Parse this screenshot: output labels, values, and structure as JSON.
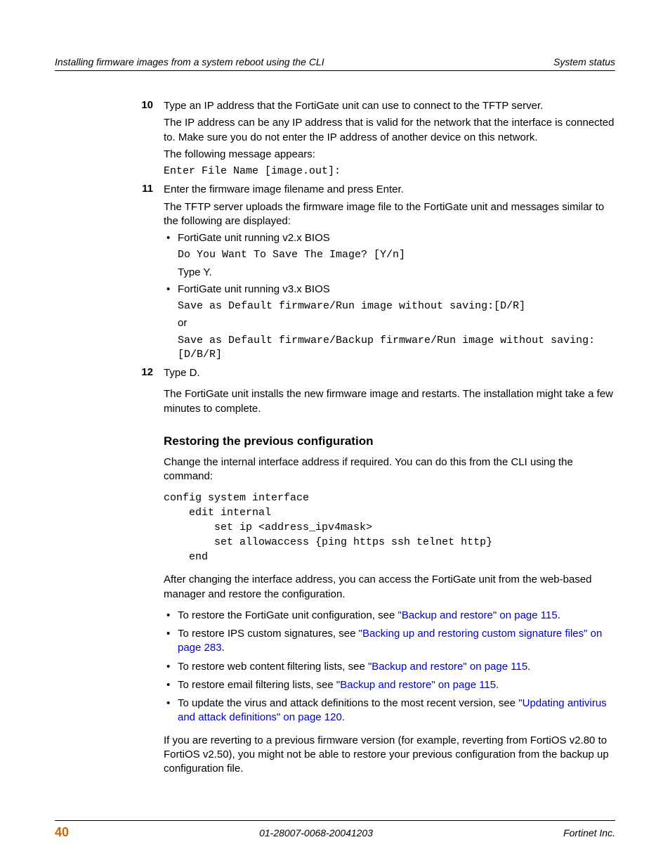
{
  "header": {
    "left": "Installing firmware images from a system reboot using the CLI",
    "right": "System status"
  },
  "steps": {
    "s10": {
      "num": "10",
      "p1": "Type an IP address that the FortiGate unit can use to connect to the TFTP server.",
      "p2": "The IP address can be any IP address that is valid for the network that the interface is connected to. Make sure you do not enter the IP address of another device on this network.",
      "p3": "The following message appears:",
      "code": "Enter File Name [image.out]:"
    },
    "s11": {
      "num": "11",
      "p1": "Enter the firmware image filename and press Enter.",
      "p2": "The TFTP server uploads the firmware image file to the FortiGate unit and messages similar to the following are displayed:",
      "b1": "FortiGate unit running v2.x BIOS",
      "c1": "Do You Want To Save The Image? [Y/n]",
      "t1": "Type Y.",
      "b2": "FortiGate unit running v3.x BIOS",
      "c2": "Save as Default firmware/Run image without saving:[D/R]",
      "or": "or",
      "c3": "Save as Default firmware/Backup firmware/Run image without saving:[D/B/R]"
    },
    "s12": {
      "num": "12",
      "p1": "Type D.",
      "p2": "The FortiGate unit installs the new firmware image and restarts. The installation might take a few minutes to complete."
    }
  },
  "section": {
    "heading": "Restoring the previous configuration",
    "p1": "Change the internal interface address if required. You can do this from the CLI using the command:",
    "code": "config system interface\n    edit internal\n        set ip <address_ipv4mask>\n        set allowaccess {ping https ssh telnet http}\n    end",
    "p2": "After changing the interface address, you can access the FortiGate unit from the web-based manager and restore the configuration.",
    "bullets": {
      "b1a": "To restore the FortiGate unit configuration, see ",
      "b1l": "\"Backup and restore\" on page 115",
      "b1e": ".",
      "b2a": "To restore IPS custom signatures, see ",
      "b2l": "\"Backing up and restoring custom signature files\" on page 283",
      "b2e": ".",
      "b3a": "To restore web content filtering lists, see ",
      "b3l": "\"Backup and restore\" on page 115",
      "b3e": ".",
      "b4a": "To restore email filtering lists, see ",
      "b4l": "\"Backup and restore\" on page 115",
      "b4e": ".",
      "b5a": "To update the virus and attack definitions to the most recent version, see ",
      "b5l": "\"Updating antivirus and attack definitions\" on page 120",
      "b5e": "."
    },
    "p3": "If you are reverting to a previous firmware version (for example, reverting from FortiOS v2.80 to FortiOS v2.50), you might not be able to restore your previous configuration from the backup up configuration file."
  },
  "footer": {
    "page": "40",
    "docid": "01-28007-0068-20041203",
    "company": "Fortinet Inc."
  }
}
